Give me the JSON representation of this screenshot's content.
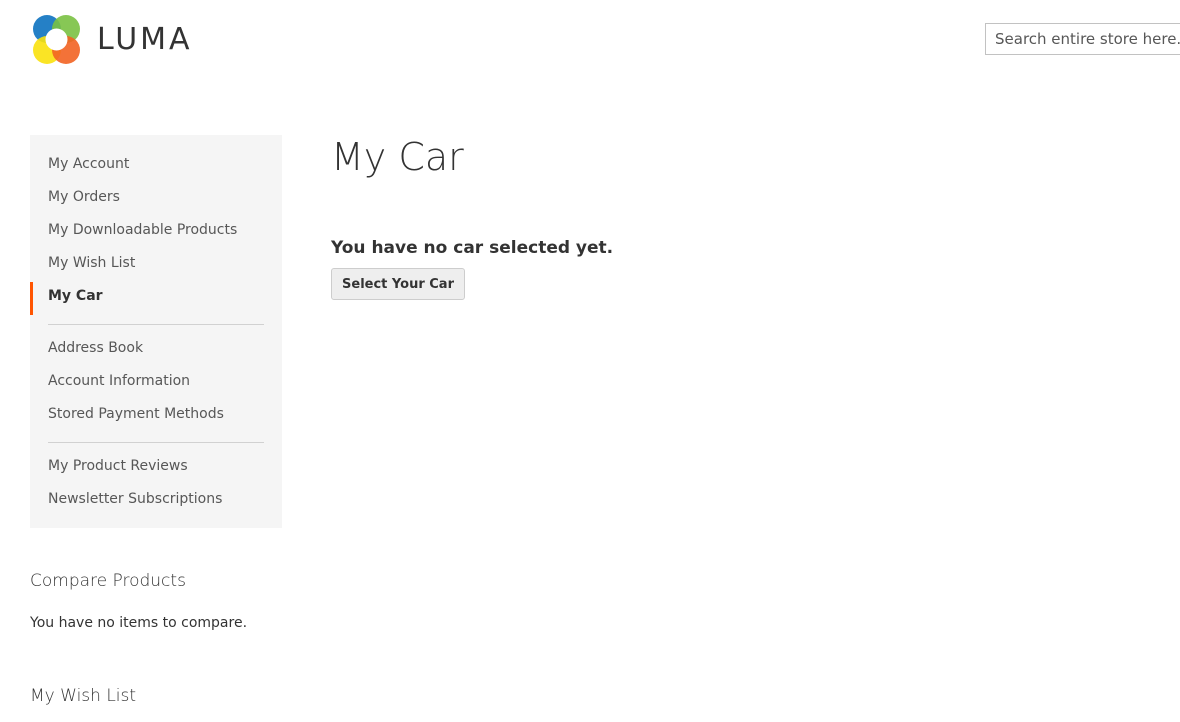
{
  "header": {
    "logo_text": "LUMA",
    "search": {
      "placeholder": "Search entire store here..."
    }
  },
  "colors": {
    "accent": "#ff5501",
    "nav_background": "#f5f5f5",
    "logo_blue": "#1979c3",
    "logo_green": "#7ac142",
    "logo_yellow": "#f9e10d",
    "logo_orange": "#f26322"
  },
  "sidebar": {
    "groups": [
      {
        "items": [
          {
            "label": "My Account",
            "current": false
          },
          {
            "label": "My Orders",
            "current": false
          },
          {
            "label": "My Downloadable Products",
            "current": false
          },
          {
            "label": "My Wish List",
            "current": false
          },
          {
            "label": "My Car",
            "current": true
          }
        ]
      },
      {
        "items": [
          {
            "label": "Address Book",
            "current": false
          },
          {
            "label": "Account Information",
            "current": false
          },
          {
            "label": "Stored Payment Methods",
            "current": false
          }
        ]
      },
      {
        "items": [
          {
            "label": "My Product Reviews",
            "current": false
          },
          {
            "label": "Newsletter Subscriptions",
            "current": false
          }
        ]
      }
    ]
  },
  "main": {
    "title": "My Car",
    "message": "You have no car selected yet.",
    "select_button": "Select Your Car"
  },
  "compare": {
    "title": "Compare Products",
    "empty": "You have no items to compare."
  },
  "wishlist": {
    "title": "My Wish List"
  }
}
